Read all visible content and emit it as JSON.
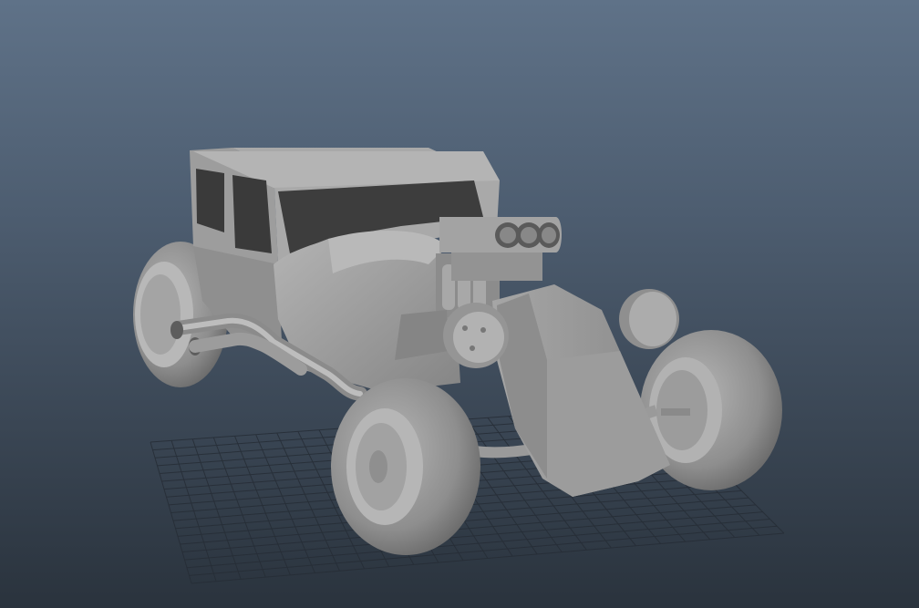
{
  "viewport": {
    "background_top": "#5f7288",
    "background_bottom": "#2a333d",
    "grid_color": "#262d36",
    "model_color": "#9a9a9a",
    "model_shadow": "#6f6f6f",
    "model_highlight": "#bdbdbd",
    "window_color": "#3c3c3c"
  },
  "model": {
    "icon": "hot-rod-car-icon"
  }
}
